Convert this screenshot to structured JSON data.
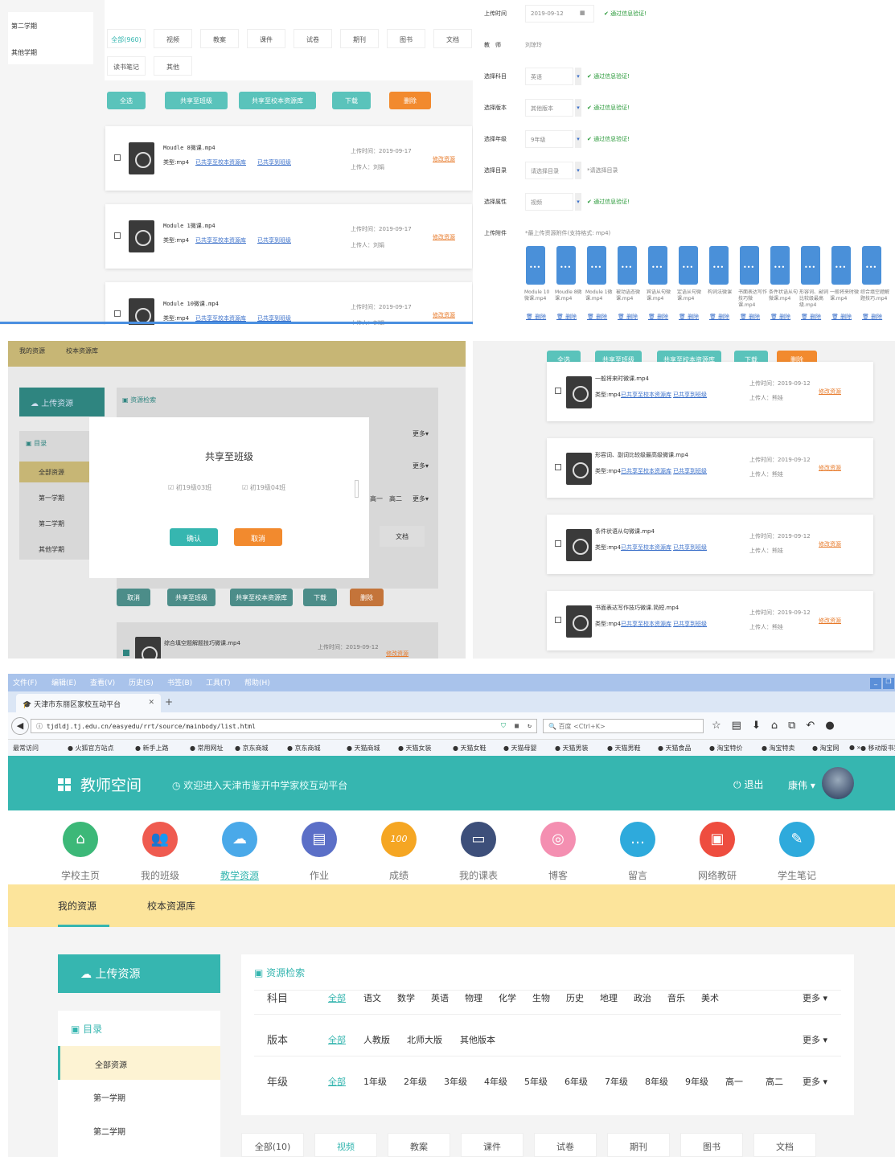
{
  "top_left": {
    "sidebar_items": [
      "第二学期",
      "其他学期"
    ],
    "filter_chips": [
      "全部(960)",
      "视频",
      "教案",
      "课件",
      "试卷",
      "期刊",
      "图书",
      "文档",
      "读书笔记",
      "其他"
    ],
    "action_buttons": [
      "全选",
      "共享至班级",
      "共享至校本资源库",
      "下载",
      "删除"
    ],
    "resources": [
      {
        "name": "Moudle 8微课.mp4",
        "type": "类型:mp4",
        "link1": "已共享至校本资源库",
        "link2": "已共享到班级",
        "time": "上传时间：2019-09-17",
        "uploader": "上传人：刘娟",
        "edit": "修改资源"
      },
      {
        "name": "Module 1微课.mp4",
        "type": "类型:mp4",
        "link1": "已共享至校本资源库",
        "link2": "已共享到班级",
        "time": "上传时间：2019-09-17",
        "uploader": "上传人：刘娟",
        "edit": "修改资源"
      },
      {
        "name": "Module 10微课.mp4",
        "type": "类型:mp4",
        "link1": "已共享至校本资源库",
        "link2": "已共享到班级",
        "time": "上传时间：2019-09-17",
        "uploader": "上传人：刘娟",
        "edit": "修改资源"
      }
    ]
  },
  "top_right": {
    "rows": [
      {
        "label": "上传时间",
        "value": "2019-09-12",
        "status": "通过信息验证!"
      },
      {
        "label": "教　师",
        "value": "刘琼玲",
        "status": ""
      },
      {
        "label": "选择科目",
        "value": "英语",
        "status": "通过信息验证!"
      },
      {
        "label": "选择版本",
        "value": "其他版本",
        "status": "通过信息验证!"
      },
      {
        "label": "选择年级",
        "value": "9年级",
        "status": "通过信息验证!"
      },
      {
        "label": "选择目录",
        "value": "请选择目录",
        "status": "*请选择目录"
      },
      {
        "label": "选择属性",
        "value": "视频",
        "status": "通过信息验证!"
      },
      {
        "label": "上传附件",
        "value": "*最上传资源附件(支持格式: mp4)",
        "status": ""
      }
    ],
    "files": [
      "Module 10微课.mp4",
      "Moudle 8微课.mp4",
      "Module 1微课.mp4",
      "被动语态微课.mp4",
      "宾语从句微课.mp4",
      "定语从句微课.mp4",
      "构词法微课",
      "书面表达写作技巧微课.mp4",
      "条件状语从句微课.mp4",
      "形容词、副词比较级最高级.mp4",
      "一般将来时微课.mp4",
      "综合填空题解题技巧.mp4"
    ],
    "delete_label": "删除"
  },
  "middle_left": {
    "tabs": [
      "我的资源",
      "校本资源库"
    ],
    "upload": "上传资源",
    "search_title": "资源检索",
    "dir_title": "目录",
    "dir_items": [
      "全部资源",
      "第一学期",
      "第二学期",
      "其他学期"
    ],
    "modal_title": "共享至班级",
    "modal_options": [
      "初19级03班",
      "初19级04班"
    ],
    "modal_confirm": "确认",
    "modal_cancel": "取消",
    "more": "更多",
    "grade_tail": [
      "高一",
      "高二"
    ],
    "bg_buttons": [
      "取消",
      "共享至班级",
      "共享至校本资源库",
      "下载",
      "删除"
    ],
    "doc_chip": "文档",
    "bg_resource": "综合填空题解题技巧微课.mp4",
    "bg_resource_time": "上传时间：2019-09-12",
    "bg_resource_edit": "修改资源"
  },
  "middle_right": {
    "action_buttons": [
      "全选",
      "共享至班级",
      "共享至校本资源库",
      "下载",
      "删除"
    ],
    "resources": [
      {
        "name": "一般将来时微课.mp4",
        "type": "类型:mp4",
        "link1": "已共享至校本资源库",
        "link2": "已共享到班级",
        "time": "上传时间：2019-09-12",
        "uploader": "上传人：熊娃",
        "edit": "修改资源"
      },
      {
        "name": "形容词、副词比较级最高级微课.mp4",
        "type": "类型:mp4",
        "link1": "已共享至校本资源库",
        "link2": "已共享到班级",
        "time": "上传时间：2019-09-12",
        "uploader": "上传人：熊娃",
        "edit": "修改资源"
      },
      {
        "name": "条件状语从句微课.mp4",
        "type": "类型:mp4",
        "link1": "已共享至校本资源库",
        "link2": "已共享到班级",
        "time": "上传时间：2019-09-12",
        "uploader": "上传人：熊娃",
        "edit": "修改资源"
      },
      {
        "name": "书面表达写作技巧微课.简短.mp4",
        "type": "类型:mp4",
        "link1": "已共享至校本资源库",
        "link2": "已共享到班级",
        "time": "上传时间：2019-09-12",
        "uploader": "上传人：熊娃",
        "edit": "修改资源"
      }
    ]
  },
  "browser": {
    "menu": [
      "文件(F)",
      "编辑(E)",
      "查看(V)",
      "历史(S)",
      "书签(B)",
      "工具(T)",
      "帮助(H)"
    ],
    "tab_title": "天津市东丽区家校互动平台",
    "url": "tjdldj.tj.edu.cn/easyedu/rrt/source/mainbody/list.html",
    "search_placeholder": "百度 <Ctrl+K>",
    "bookmarks": [
      "最常访问",
      "火狐官方站点",
      "新手上路",
      "常用网址",
      "京东商城",
      "京东商城",
      "天猫商城",
      "天猫女装",
      "天猫女鞋",
      "天猫母婴",
      "天猫男装",
      "天猫男鞋",
      "天猫食品",
      "淘宝特价",
      "淘宝特卖",
      "淘宝网",
      "»",
      "移动版书签"
    ]
  },
  "app": {
    "title": "教师空间",
    "welcome": "欢迎进入天津市鉴开中学家校互动平台",
    "logout": "退出",
    "user": "康伟",
    "nav": [
      {
        "label": "学校主页",
        "color": "#3cb878"
      },
      {
        "label": "我的班级",
        "color": "#ef5b50"
      },
      {
        "label": "教学资源",
        "color": "#4aa9e9"
      },
      {
        "label": "作业",
        "color": "#5b6fc7"
      },
      {
        "label": "成绩",
        "color": "#f5a623"
      },
      {
        "label": "我的课表",
        "color": "#3d4f7a"
      },
      {
        "label": "博客",
        "color": "#f48fb1"
      },
      {
        "label": "留言",
        "color": "#2eaadc"
      },
      {
        "label": "网络教研",
        "color": "#ee4d3f"
      },
      {
        "label": "学生笔记",
        "color": "#2eaadc"
      }
    ],
    "subtabs": [
      "我的资源",
      "校本资源库"
    ],
    "upload": "上传资源",
    "dir_title": "目录",
    "dir_items": [
      "全部资源",
      "第一学期",
      "第二学期"
    ],
    "search_title": "资源检索",
    "filters": [
      {
        "label": "科目",
        "options": [
          "全部",
          "语文",
          "数学",
          "英语",
          "物理",
          "化学",
          "生物",
          "历史",
          "地理",
          "政治",
          "音乐",
          "美术"
        ]
      },
      {
        "label": "版本",
        "options": [
          "全部",
          "人教版",
          "北师大版",
          "其他版本"
        ]
      },
      {
        "label": "年级",
        "options": [
          "全部",
          "1年级",
          "2年级",
          "3年级",
          "4年级",
          "5年级",
          "6年级",
          "7年级",
          "8年级",
          "9年级",
          "高一",
          "高二"
        ]
      }
    ],
    "more": "更多",
    "type_chips": [
      "全部(10)",
      "视频",
      "教案",
      "课件",
      "试卷",
      "期刊",
      "图书",
      "文档"
    ],
    "colors": {
      "teal": "#36b6b0",
      "yellow": "#fce49b",
      "orange": "#f28a2e"
    }
  }
}
